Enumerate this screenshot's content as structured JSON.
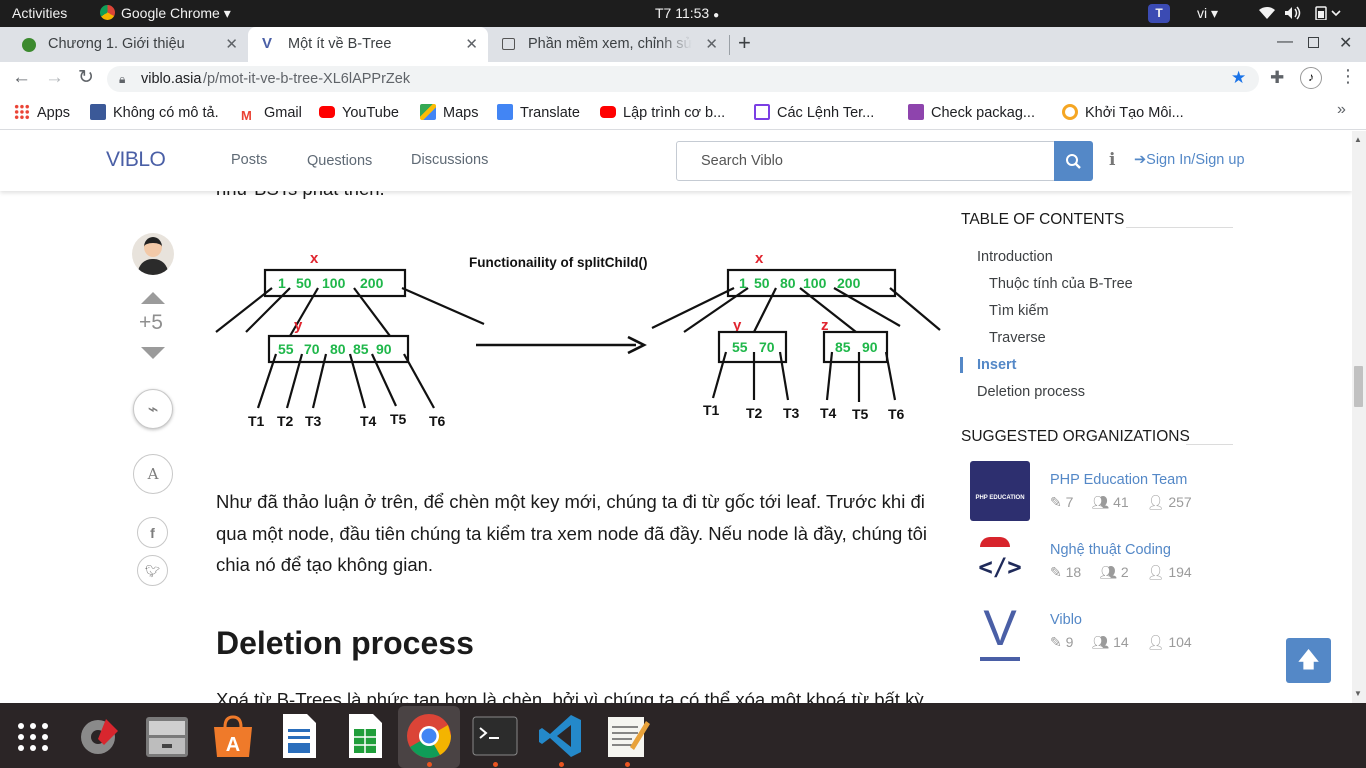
{
  "system": {
    "activities": "Activities",
    "app_name": "Google Chrome",
    "clock": "T7 11:53",
    "lang": "vi"
  },
  "tabs": [
    {
      "title": "Chương 1. Giới thiệu"
    },
    {
      "title": "Một ít về B-Tree"
    },
    {
      "title": "Phần mềm xem, chỉnh sửa"
    }
  ],
  "address": {
    "host": "viblo.asia",
    "path": "/p/mot-it-ve-b-tree-XL6lAPPrZek"
  },
  "bookmarks": [
    {
      "label": "Apps"
    },
    {
      "label": "Không có mô tả."
    },
    {
      "label": "Gmail"
    },
    {
      "label": "YouTube"
    },
    {
      "label": "Maps"
    },
    {
      "label": "Translate"
    },
    {
      "label": "Lập trình cơ b..."
    },
    {
      "label": "Các Lệnh Ter..."
    },
    {
      "label": "Check packag..."
    },
    {
      "label": "Khởi Tạo Môi..."
    }
  ],
  "viblo": {
    "logo": "VIBLO",
    "nav": [
      "Posts",
      "Questions",
      "Discussions"
    ],
    "search_placeholder": "Search Viblo",
    "signin": "Sign In/Sign up"
  },
  "post": {
    "cut_line": "như BSTs phát triển.",
    "vote_count": "+5",
    "font_button": "A",
    "figure": {
      "caption": "Functionaility of splitChild()",
      "left": {
        "root_label": "x",
        "root_keys": [
          "1",
          "50",
          "100",
          "200"
        ],
        "child_label": "y",
        "child_keys": [
          "55",
          "70",
          "80",
          "85",
          "90"
        ],
        "leaves": [
          "T1",
          "T2",
          "T3",
          "T4",
          "T5",
          "T6"
        ]
      },
      "right": {
        "root_label": "x",
        "root_keys": [
          "1",
          "50",
          "80",
          "100",
          "200"
        ],
        "child_y_label": "y",
        "child_y_keys": [
          "55",
          "70"
        ],
        "child_z_label": "z",
        "child_z_keys": [
          "85",
          "90"
        ],
        "leaves": [
          "T1",
          "T2",
          "T3",
          "T4",
          "T5",
          "T6"
        ]
      }
    },
    "paragraph": "Như đã thảo luận ở trên, để chèn một key mới, chúng ta đi từ gốc tới leaf. Trước khi đi qua một node, đầu tiên chúng ta kiểm tra xem node đã đầy. Nếu node là đầy, chúng tôi chia nó để tạo không gian.",
    "heading": "Deletion process",
    "cut_bottom": "Xoá từ B-Trees là phức tạp hơn là chèn, bởi vì chúng ta có thể xóa một khoá từ bất kỳ"
  },
  "toc": {
    "title": "TABLE OF CONTENTS",
    "items": [
      {
        "label": "Introduction",
        "level": 1,
        "active": false
      },
      {
        "label": "Thuộc tính của B-Tree",
        "level": 2,
        "active": false
      },
      {
        "label": "Tìm kiếm",
        "level": 2,
        "active": false
      },
      {
        "label": "Traverse",
        "level": 2,
        "active": false
      },
      {
        "label": "Insert",
        "level": 1,
        "active": true
      },
      {
        "label": "Deletion process",
        "level": 1,
        "active": false
      }
    ]
  },
  "orgs": {
    "title": "SUGGESTED ORGANIZATIONS",
    "items": [
      {
        "name": "PHP Education Team",
        "posts": "7",
        "members": "41",
        "followers": "257",
        "logo_text": "PHP EDUCATION"
      },
      {
        "name": "Nghệ thuật Coding",
        "posts": "18",
        "members": "2",
        "followers": "194",
        "logo_text": "</>"
      },
      {
        "name": "Viblo",
        "posts": "9",
        "members": "14",
        "followers": "104",
        "logo_text": "V"
      }
    ]
  },
  "colors": {
    "accent": "#5488c7",
    "tree_keys": "#1fb74a",
    "tree_labels": "#e0252f"
  }
}
